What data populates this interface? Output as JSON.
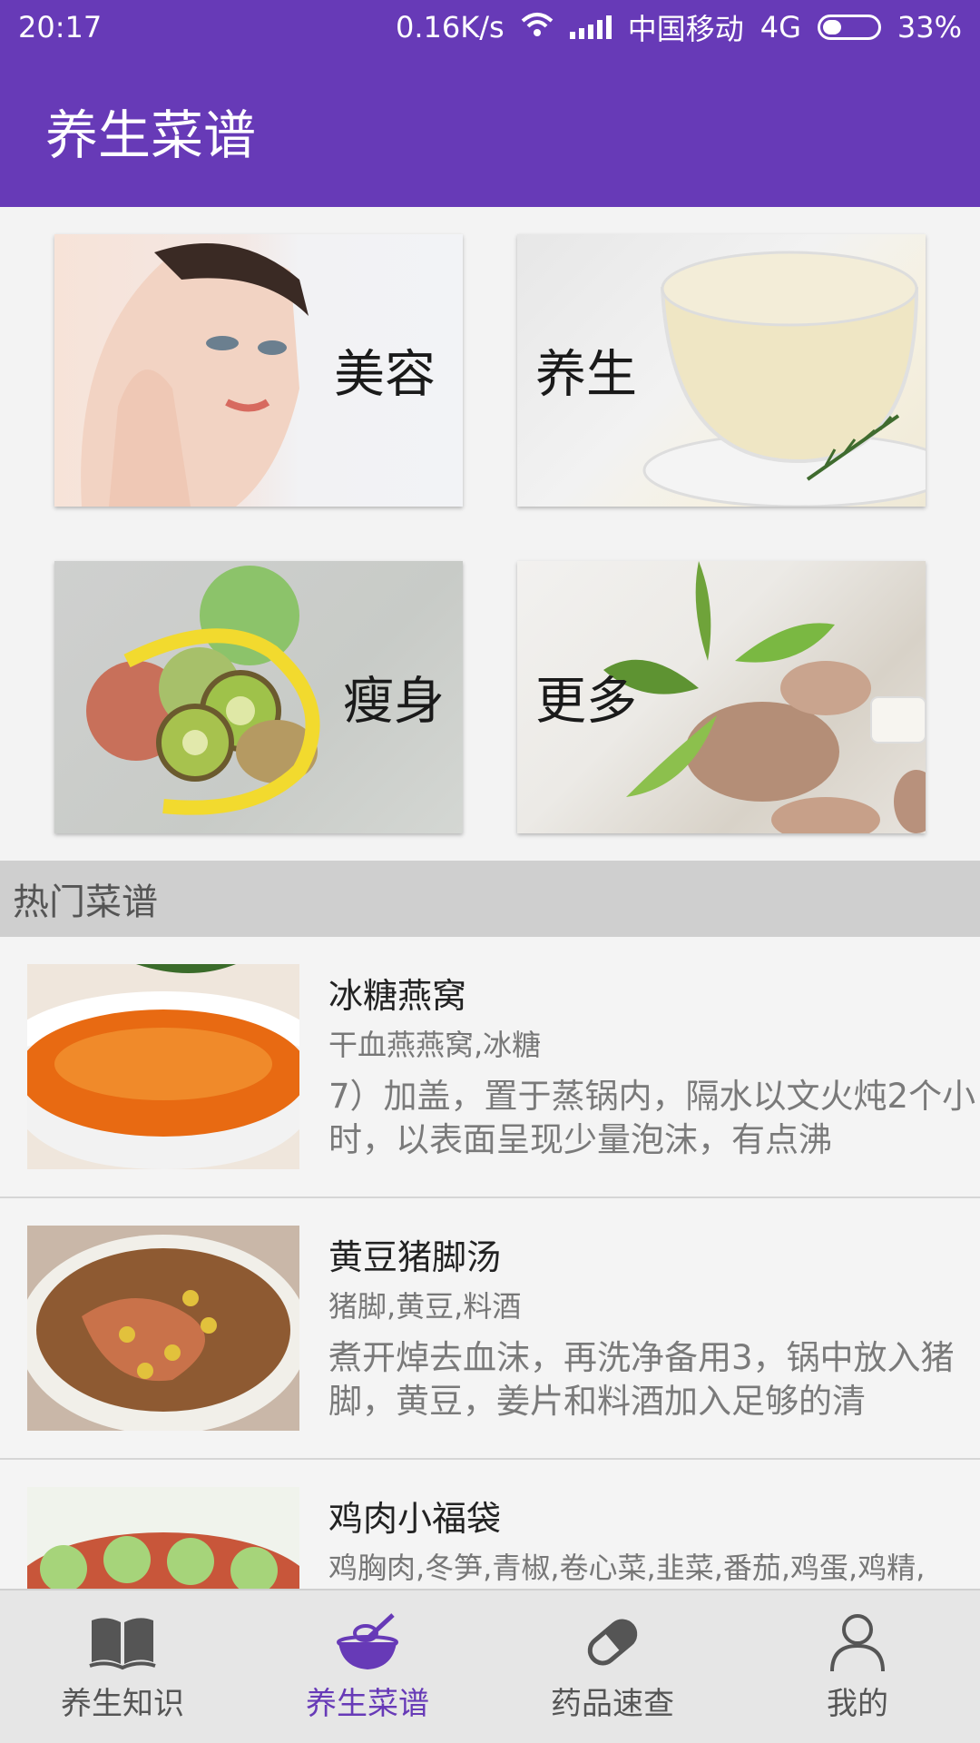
{
  "status_bar": {
    "time": "20:17",
    "speed": "0.16K/s",
    "carrier": "中国移动",
    "network": "4G",
    "battery": "33%"
  },
  "app_bar": {
    "title": "养生菜谱"
  },
  "categories": [
    {
      "label": "美容"
    },
    {
      "label": "养生"
    },
    {
      "label": "瘦身"
    },
    {
      "label": "更多"
    }
  ],
  "section": {
    "title": "热门菜谱"
  },
  "recipes": [
    {
      "title": "冰糖燕窝",
      "ingredients": "干血燕燕窝,冰糖",
      "description": "7）加盖，置于蒸锅内，隔水以文火炖2个小时，以表面呈现少量泡沫，有点沸"
    },
    {
      "title": "黄豆猪脚汤",
      "ingredients": "猪脚,黄豆,料酒",
      "description": "煮开焯去血沫，再洗净备用3，锅中放入猪脚，黄豆，姜片和料酒加入足够的清"
    },
    {
      "title": "鸡肉小福袋",
      "ingredients": "鸡胸肉,冬笋,青椒,卷心菜,韭菜,番茄,鸡蛋,鸡精,",
      "description": ""
    }
  ],
  "bottom_nav": [
    {
      "label": "养生知识",
      "icon": "book-icon"
    },
    {
      "label": "养生菜谱",
      "icon": "cooking-bowl-icon",
      "active": true
    },
    {
      "label": "药品速查",
      "icon": "pill-icon"
    },
    {
      "label": "我的",
      "icon": "person-icon"
    }
  ],
  "colors": {
    "primary": "#673ab7",
    "section_bg": "#cfcfcf",
    "nav_bg": "#e6e6e6"
  }
}
